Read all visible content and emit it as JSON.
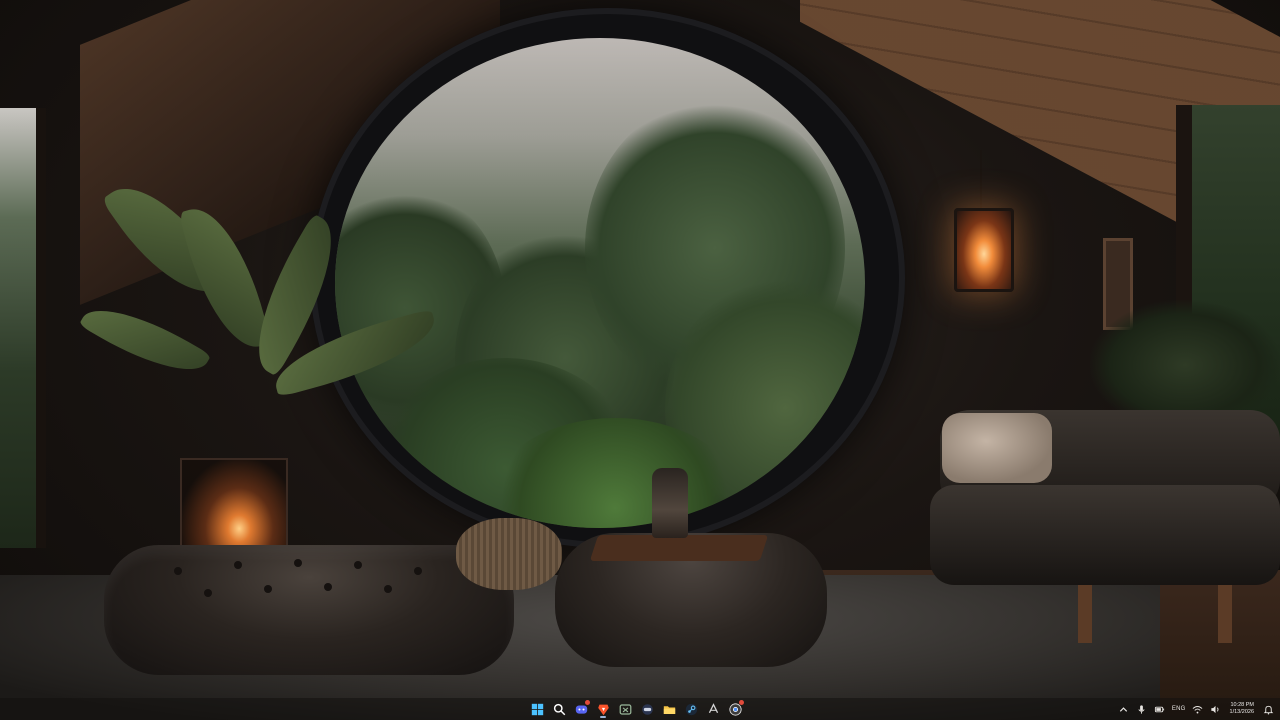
{
  "desktop": {
    "wallpaper": "cozy-cabin-round-window-rainforest"
  },
  "taskbar": {
    "pinned_apps": [
      {
        "name": "start-button",
        "icon": "windows-logo-icon",
        "color": "#4cc2ff"
      },
      {
        "name": "search-button",
        "icon": "search-icon",
        "color": "#ffffff"
      },
      {
        "name": "app-discord",
        "icon": "discord-icon",
        "color": "#5865f2",
        "badge": true
      },
      {
        "name": "app-brave",
        "icon": "brave-browser-icon",
        "color": "#fb542b",
        "active": true
      },
      {
        "name": "app-xbox",
        "icon": "xbox-icon",
        "color": "#9ab89a"
      },
      {
        "name": "app-steamvr",
        "icon": "headset-icon",
        "color": "#cfd6e6"
      },
      {
        "name": "app-file-explorer",
        "icon": "folder-icon",
        "color": "#f5c447"
      },
      {
        "name": "app-steam",
        "icon": "steam-icon",
        "color": "#66c0f4"
      },
      {
        "name": "app-terminal",
        "icon": "terminal-icon",
        "color": "#d6d6d6"
      },
      {
        "name": "app-chrome",
        "icon": "chrome-icon",
        "color": "#e8e8e8",
        "badge": true
      }
    ],
    "tray": {
      "chevron": "chevron-up-icon",
      "icons": [
        "microphone-icon",
        "battery-icon",
        "wifi-icon",
        "volume-icon"
      ],
      "language": "ENG",
      "time": "10:28 PM",
      "date": "1/13/2026",
      "notification_icon": "bell-icon"
    }
  }
}
